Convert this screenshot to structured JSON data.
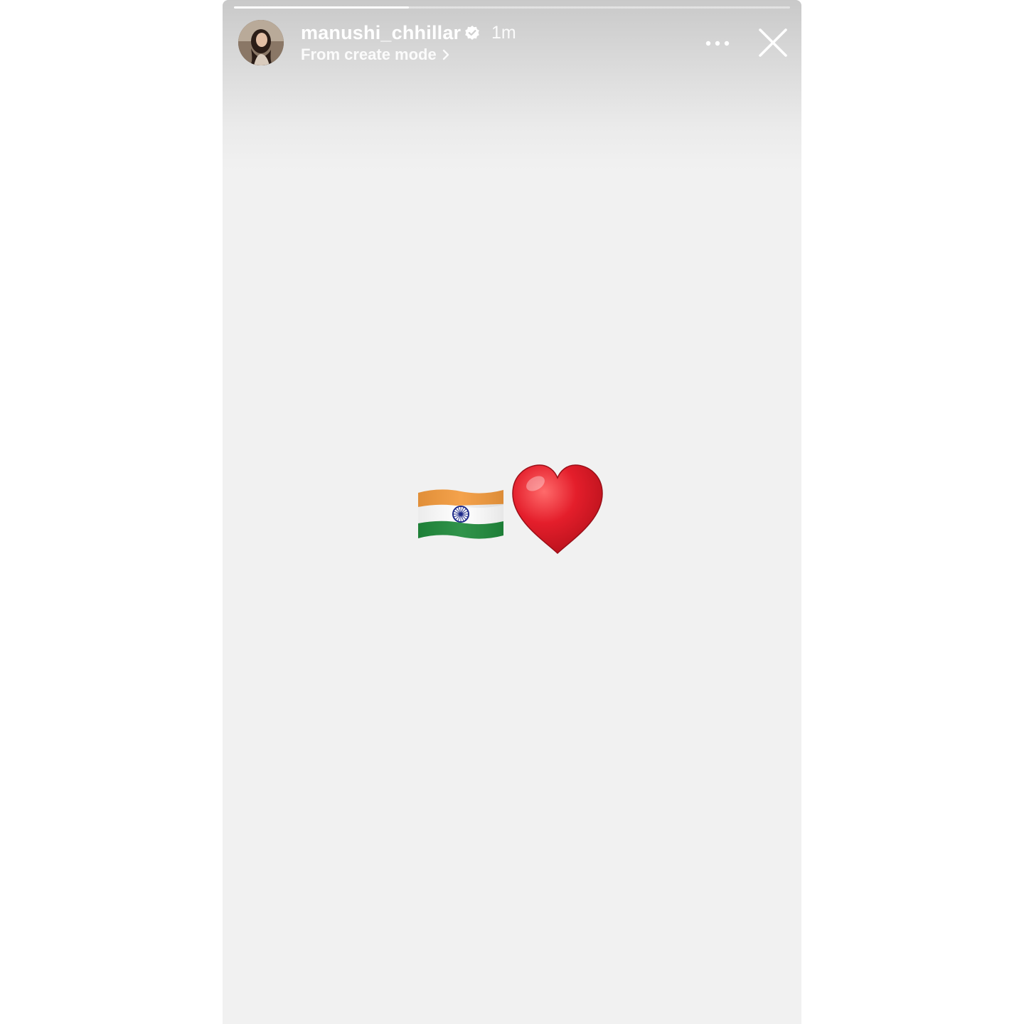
{
  "story": {
    "progress": 0.314,
    "username": "manushi_chhillar",
    "verified": true,
    "timestamp": "1m",
    "subtitle": "From create mode",
    "subtitle_icon": "chevron-right-icon",
    "more_icon": "more-horizontal-icon",
    "close_icon": "close-icon",
    "stickers": [
      "india-flag-emoji",
      "red-heart-emoji"
    ]
  },
  "colors": {
    "background": "#f1f1f1",
    "header_text": "#ffffff",
    "flag_saffron": "#f39a3c",
    "flag_green": "#1f8a3b",
    "chakra_blue": "#1e2a8a",
    "heart_red": "#e41e2b"
  }
}
